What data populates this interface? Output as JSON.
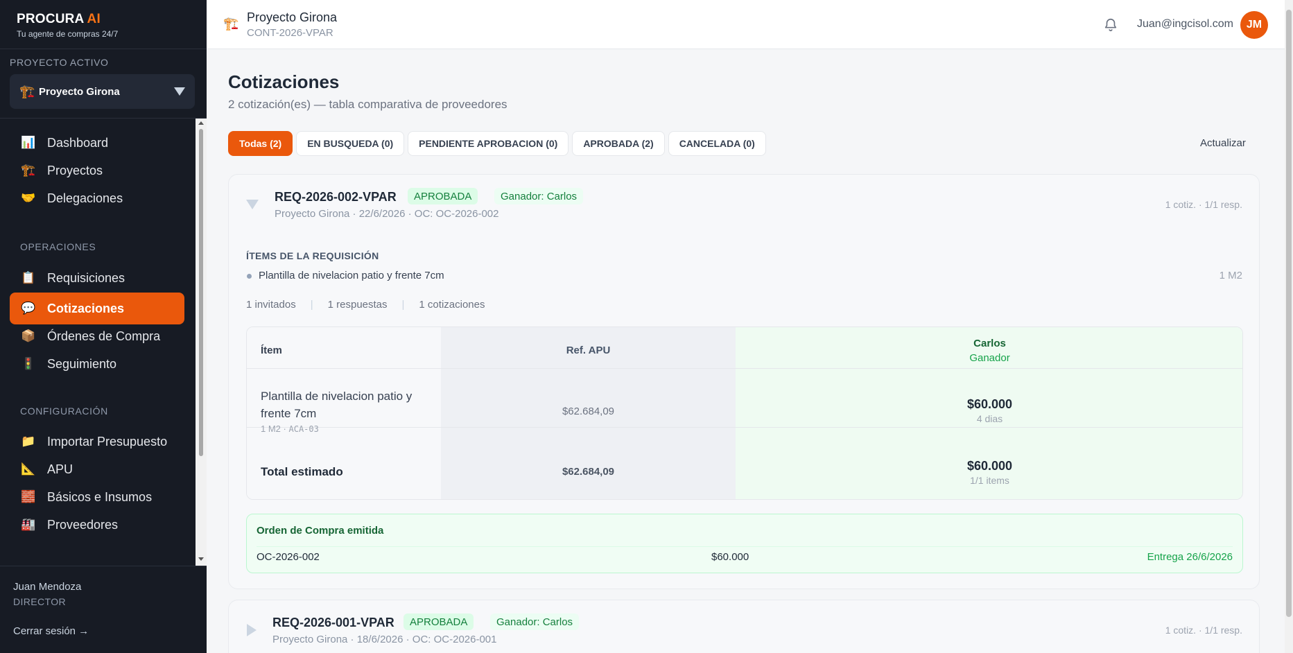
{
  "brand": {
    "name": "PROCURA",
    "ai": "AI",
    "tagline": "Tu agente de compras 24/7"
  },
  "project_selector": {
    "label": "PROYECTO ACTIVO",
    "icon": "construction-crane-emoji",
    "value": "Proyecto Girona"
  },
  "nav": {
    "items": [
      {
        "label": "Dashboard",
        "icon": "📊"
      },
      {
        "label": "Proyectos",
        "icon": "🏗️"
      },
      {
        "label": "Delegaciones",
        "icon": "🤝"
      }
    ],
    "operaciones_label": "OPERACIONES",
    "operaciones": [
      {
        "label": "Requisiciones",
        "icon": "📋"
      },
      {
        "label": "Cotizaciones",
        "icon": "💬",
        "active": true
      },
      {
        "label": "Órdenes de Compra",
        "icon": "📦"
      },
      {
        "label": "Seguimiento",
        "icon": "🚦"
      }
    ],
    "configuracion_label": "CONFIGURACIÓN",
    "configuracion": [
      {
        "label": "Importar Presupuesto",
        "icon": "📁"
      },
      {
        "label": "APU",
        "icon": "📐"
      },
      {
        "label": "Básicos e Insumos",
        "icon": "🧱"
      },
      {
        "label": "Proveedores",
        "icon": "🏭"
      }
    ]
  },
  "user": {
    "name": "Juan Mendoza",
    "role": "DIRECTOR",
    "logout": "Cerrar sesión →",
    "email": "Juan@ingcisol.com",
    "initials": "JM"
  },
  "topbar": {
    "icon": "🏗️",
    "project": "Proyecto Girona",
    "contract": "CONT-2026-VPAR"
  },
  "page": {
    "title": "Cotizaciones",
    "subtitle": "2 cotización(es) — tabla comparativa de proveedores",
    "refresh": "Actualizar"
  },
  "tabs": [
    {
      "label": "Todas (2)",
      "active": true
    },
    {
      "label": "EN BUSQUEDA (0)"
    },
    {
      "label": "PENDIENTE APROBACION (0)"
    },
    {
      "label": "APROBADA (2)"
    },
    {
      "label": "CANCELADA (0)"
    }
  ],
  "requisitions": [
    {
      "code": "REQ-2026-002-VPAR",
      "status": "APROBADA",
      "winner": "Ganador: Carlos",
      "meta": "Proyecto Girona · 22/6/2026 · OC: OC-2026-002",
      "count": "1 cotiz. · 1/1 resp.",
      "expanded": true,
      "items_title": "ÍTEMS DE LA REQUISICIÓN",
      "items": [
        {
          "name": "Plantilla de nivelacion patio y frente 7cm",
          "qty": "1 M2"
        }
      ],
      "stats": [
        "1 invitados",
        "1 respuestas",
        "1 cotizaciones"
      ],
      "table": {
        "col_item": "Ítem",
        "col_apu": "Ref. APU",
        "supplier": "Carlos",
        "supplier_tag": "Ganador",
        "row": {
          "name": "Plantilla de nivelacion patio y frente 7cm",
          "qty": "1 M2",
          "dot": "·",
          "code": "ACA-03",
          "apu": "$62.684,09",
          "price": "$60.000",
          "days": "4 dias"
        },
        "total": {
          "label": "Total estimado",
          "apu": "$62.684,09",
          "price": "$60.000",
          "items": "1/1 items"
        }
      },
      "purchase_order": {
        "title": "Orden de Compra emitida",
        "number": "OC-2026-002",
        "amount": "$60.000",
        "delivery": "Entrega 26/6/2026"
      }
    },
    {
      "code": "REQ-2026-001-VPAR",
      "status": "APROBADA",
      "winner": "Ganador: Carlos",
      "meta": "Proyecto Girona · 18/6/2026 · OC: OC-2026-001",
      "count": "1 cotiz. · 1/1 resp.",
      "expanded": false
    }
  ],
  "colors": {
    "accent": "#ea580c",
    "sidebar": "#171b24",
    "success": "#16a34a",
    "success_bg": "#dcfce7"
  }
}
